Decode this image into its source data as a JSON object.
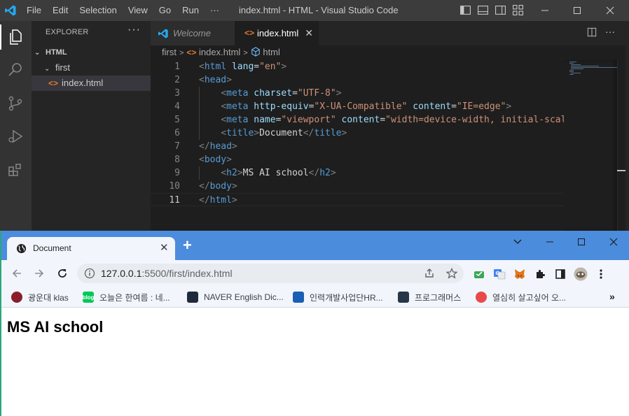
{
  "vscode": {
    "menu": [
      "File",
      "Edit",
      "Selection",
      "View",
      "Go",
      "Run",
      "···"
    ],
    "window_title": "index.html - HTML - Visual Studio Code",
    "explorer": {
      "header": "EXPLORER",
      "more": "···",
      "root": "HTML",
      "folder": "first",
      "file": "index.html"
    },
    "tabs": [
      {
        "label": "Welcome",
        "active": false
      },
      {
        "label": "index.html",
        "active": true
      }
    ],
    "breadcrumb": [
      "first",
      "index.html",
      "html"
    ],
    "line_numbers": [
      "1",
      "2",
      "3",
      "4",
      "5",
      "6",
      "7",
      "8",
      "9",
      "10",
      "11"
    ],
    "current_line": 11,
    "colors": {
      "tag": "#569cd6",
      "attr": "#9cdcfe",
      "string": "#ce9178",
      "bracket": "#808080",
      "text": "#d4d4d4",
      "html_icon": "#e37933",
      "vscode_blue": "#23a9f2"
    },
    "code": [
      [
        [
          "br",
          "<"
        ],
        [
          "tag",
          "html"
        ],
        [
          "txt",
          " "
        ],
        [
          "attr",
          "lang"
        ],
        [
          "txt",
          "="
        ],
        [
          "str",
          "\"en\""
        ],
        [
          "br",
          ">"
        ]
      ],
      [
        [
          "br",
          "<"
        ],
        [
          "tag",
          "head"
        ],
        [
          "br",
          ">"
        ]
      ],
      [
        [
          "txt",
          "    "
        ],
        [
          "br",
          "<"
        ],
        [
          "tag",
          "meta"
        ],
        [
          "txt",
          " "
        ],
        [
          "attr",
          "charset"
        ],
        [
          "txt",
          "="
        ],
        [
          "str",
          "\"UTF-8\""
        ],
        [
          "br",
          ">"
        ]
      ],
      [
        [
          "txt",
          "    "
        ],
        [
          "br",
          "<"
        ],
        [
          "tag",
          "meta"
        ],
        [
          "txt",
          " "
        ],
        [
          "attr",
          "http-equiv"
        ],
        [
          "txt",
          "="
        ],
        [
          "str",
          "\"X-UA-Compatible\""
        ],
        [
          "txt",
          " "
        ],
        [
          "attr",
          "content"
        ],
        [
          "txt",
          "="
        ],
        [
          "str",
          "\"IE=edge\""
        ],
        [
          "br",
          ">"
        ]
      ],
      [
        [
          "txt",
          "    "
        ],
        [
          "br",
          "<"
        ],
        [
          "tag",
          "meta"
        ],
        [
          "txt",
          " "
        ],
        [
          "attr",
          "name"
        ],
        [
          "txt",
          "="
        ],
        [
          "str",
          "\"viewport\""
        ],
        [
          "txt",
          " "
        ],
        [
          "attr",
          "content"
        ],
        [
          "txt",
          "="
        ],
        [
          "str",
          "\"width=device-width, initial-scale"
        ]
      ],
      [
        [
          "txt",
          "    "
        ],
        [
          "br",
          "<"
        ],
        [
          "tag",
          "title"
        ],
        [
          "br",
          ">"
        ],
        [
          "txt",
          "Document"
        ],
        [
          "br",
          "</"
        ],
        [
          "tag",
          "title"
        ],
        [
          "br",
          ">"
        ]
      ],
      [
        [
          "br",
          "</"
        ],
        [
          "tag",
          "head"
        ],
        [
          "br",
          ">"
        ]
      ],
      [
        [
          "br",
          "<"
        ],
        [
          "tag",
          "body"
        ],
        [
          "br",
          ">"
        ]
      ],
      [
        [
          "txt",
          "    "
        ],
        [
          "br",
          "<"
        ],
        [
          "tag",
          "h2"
        ],
        [
          "br",
          ">"
        ],
        [
          "txt",
          "MS AI school"
        ],
        [
          "br",
          "</"
        ],
        [
          "tag",
          "h2"
        ],
        [
          "br",
          ">"
        ]
      ],
      [
        [
          "br",
          "</"
        ],
        [
          "tag",
          "body"
        ],
        [
          "br",
          ">"
        ]
      ],
      [
        [
          "br",
          "</"
        ],
        [
          "tag",
          "html"
        ],
        [
          "br",
          ">"
        ]
      ]
    ]
  },
  "chrome": {
    "tab_title": "Document",
    "tab_close": "✕",
    "new_tab": "+",
    "url_host": "127.0.0.1",
    "url_rest": ":5500/first/index.html",
    "bookmarks": [
      {
        "label": "광운대 klas",
        "color": "#8b1e2b",
        "glyph": ""
      },
      {
        "label": "오늘은 한여름 : 네...",
        "color": "#03c75a",
        "glyph": "blog"
      },
      {
        "label": "NAVER English Dic...",
        "color": "#1f2b3a",
        "glyph": ""
      },
      {
        "label": "인력개발사업단HR...",
        "color": "#1a5fb4",
        "glyph": ""
      },
      {
        "label": "프로그래머스",
        "color": "#263747",
        "glyph": ""
      },
      {
        "label": "열심히 살고싶어 오...",
        "color": "#e84a4a",
        "glyph": ""
      }
    ],
    "bookmarks_more": "»",
    "page_heading": "MS AI school"
  }
}
